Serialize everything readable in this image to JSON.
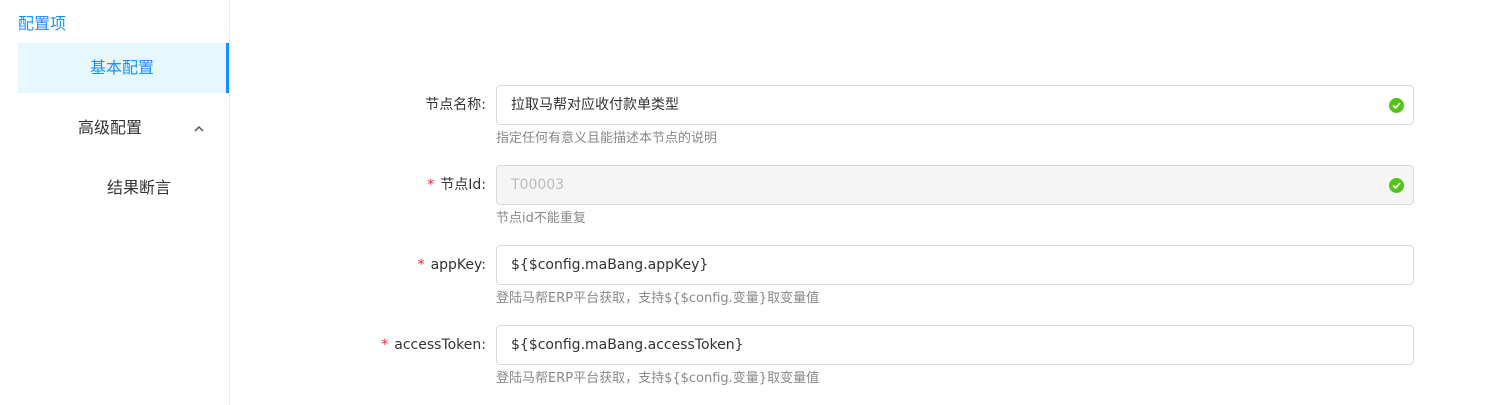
{
  "title": "配置项",
  "sidebar": {
    "items": [
      {
        "label": "基本配置"
      },
      {
        "label": "高级配置"
      },
      {
        "label": "结果断言"
      }
    ],
    "advanced_chevron": "^"
  },
  "form": {
    "node_name": {
      "label": "节点名称",
      "colon": ":",
      "value": "拉取马帮对应收付款单类型",
      "help": "指定任何有意义且能描述本节点的说明"
    },
    "node_id": {
      "required_mark": "*",
      "label": "节点Id",
      "colon": ":",
      "value": "T00003",
      "help": "节点id不能重复"
    },
    "app_key": {
      "required_mark": "*",
      "label": "appKey",
      "colon": ":",
      "value": "${$config.maBang.appKey}",
      "help": "登陆马帮ERP平台获取，支持${$config.变量}取变量值"
    },
    "access_token": {
      "required_mark": "*",
      "label": "accessToken",
      "colon": ":",
      "value": "${$config.maBang.accessToken}",
      "help": "登陆马帮ERP平台获取，支持${$config.变量}取变量值"
    }
  },
  "colors": {
    "accent": "#1890ff",
    "success": "#52c41a",
    "required": "#f5222d"
  },
  "icons": {
    "valid": "check-circle-icon",
    "chevron": "chevron-up-icon"
  }
}
